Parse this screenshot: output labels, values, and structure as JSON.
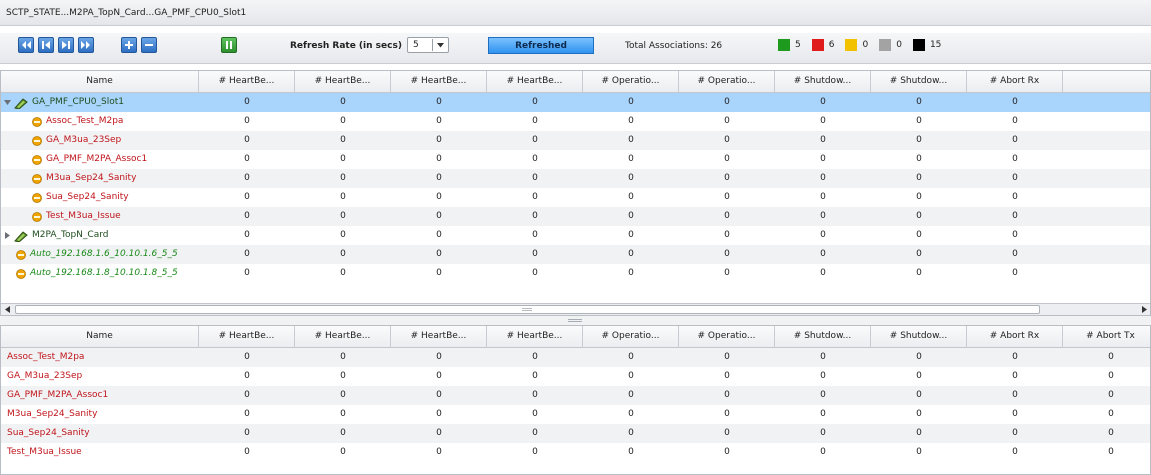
{
  "breadcrumb": "SCTP_STATE...M2PA_TopN_Card...GA_PMF_CPU0_Slot1",
  "toolbar": {
    "refresh_label": "Refresh Rate (in secs)",
    "refresh_value": "5",
    "refreshed_label": "Refreshed",
    "total_label": "Total Associations: 26",
    "legend": [
      {
        "color": "#1e9a1e",
        "count": "5"
      },
      {
        "color": "#e01b1b",
        "count": "6"
      },
      {
        "color": "#f2c200",
        "count": "0"
      },
      {
        "color": "#a3a3a3",
        "count": "0"
      },
      {
        "color": "#000000",
        "count": "15"
      }
    ]
  },
  "top_table": {
    "columns": [
      "Name",
      "# HeartBe...",
      "# HeartBe...",
      "# HeartBe...",
      "# HeartBe...",
      "# Operatio...",
      "# Operatio...",
      "# Shutdow...",
      "# Shutdow...",
      "# Abort Rx"
    ],
    "rows": [
      {
        "name": "GA_PMF_CPU0_Slot1",
        "values": [
          "0",
          "0",
          "0",
          "0",
          "0",
          "0",
          "0",
          "0",
          "0"
        ]
      },
      {
        "name": "Assoc_Test_M2pa",
        "values": [
          "0",
          "0",
          "0",
          "0",
          "0",
          "0",
          "0",
          "0",
          "0"
        ]
      },
      {
        "name": "GA_M3ua_23Sep",
        "values": [
          "0",
          "0",
          "0",
          "0",
          "0",
          "0",
          "0",
          "0",
          "0"
        ]
      },
      {
        "name": "GA_PMF_M2PA_Assoc1",
        "values": [
          "0",
          "0",
          "0",
          "0",
          "0",
          "0",
          "0",
          "0",
          "0"
        ]
      },
      {
        "name": "M3ua_Sep24_Sanity",
        "values": [
          "0",
          "0",
          "0",
          "0",
          "0",
          "0",
          "0",
          "0",
          "0"
        ]
      },
      {
        "name": "Sua_Sep24_Sanity",
        "values": [
          "0",
          "0",
          "0",
          "0",
          "0",
          "0",
          "0",
          "0",
          "0"
        ]
      },
      {
        "name": "Test_M3ua_Issue",
        "values": [
          "0",
          "0",
          "0",
          "0",
          "0",
          "0",
          "0",
          "0",
          "0"
        ]
      },
      {
        "name": "M2PA_TopN_Card",
        "values": [
          "0",
          "0",
          "0",
          "0",
          "0",
          "0",
          "0",
          "0",
          "0"
        ]
      },
      {
        "name": "Auto_192.168.1.6_10.10.1.6_5_5",
        "values": [
          "0",
          "0",
          "0",
          "0",
          "0",
          "0",
          "0",
          "0",
          "0"
        ]
      },
      {
        "name": "Auto_192.168.1.8_10.10.1.8_5_5",
        "values": [
          "0",
          "0",
          "0",
          "0",
          "0",
          "0",
          "0",
          "0",
          "0"
        ]
      }
    ]
  },
  "bottom_table": {
    "columns": [
      "Name",
      "# HeartBe...",
      "# HeartBe...",
      "# HeartBe...",
      "# HeartBe...",
      "# Operatio...",
      "# Operatio...",
      "# Shutdow...",
      "# Shutdow...",
      "# Abort Rx",
      "# Abort Tx"
    ],
    "rows": [
      {
        "name": "Assoc_Test_M2pa",
        "values": [
          "0",
          "0",
          "0",
          "0",
          "0",
          "0",
          "0",
          "0",
          "0",
          "0"
        ]
      },
      {
        "name": "GA_M3ua_23Sep",
        "values": [
          "0",
          "0",
          "0",
          "0",
          "0",
          "0",
          "0",
          "0",
          "0",
          "0"
        ]
      },
      {
        "name": "GA_PMF_M2PA_Assoc1",
        "values": [
          "0",
          "0",
          "0",
          "0",
          "0",
          "0",
          "0",
          "0",
          "0",
          "0"
        ]
      },
      {
        "name": "M3ua_Sep24_Sanity",
        "values": [
          "0",
          "0",
          "0",
          "0",
          "0",
          "0",
          "0",
          "0",
          "0",
          "0"
        ]
      },
      {
        "name": "Sua_Sep24_Sanity",
        "values": [
          "0",
          "0",
          "0",
          "0",
          "0",
          "0",
          "0",
          "0",
          "0",
          "0"
        ]
      },
      {
        "name": "Test_M3ua_Issue",
        "values": [
          "0",
          "0",
          "0",
          "0",
          "0",
          "0",
          "0",
          "0",
          "0",
          "0"
        ]
      }
    ]
  },
  "icons": {
    "first": "first-page-icon",
    "prev": "previous-page-icon",
    "next": "next-page-icon",
    "last": "last-page-icon",
    "expand": "expand-all-icon",
    "collapse": "collapse-all-icon",
    "pause": "pause-icon",
    "card": "card-icon",
    "association": "association-icon"
  }
}
